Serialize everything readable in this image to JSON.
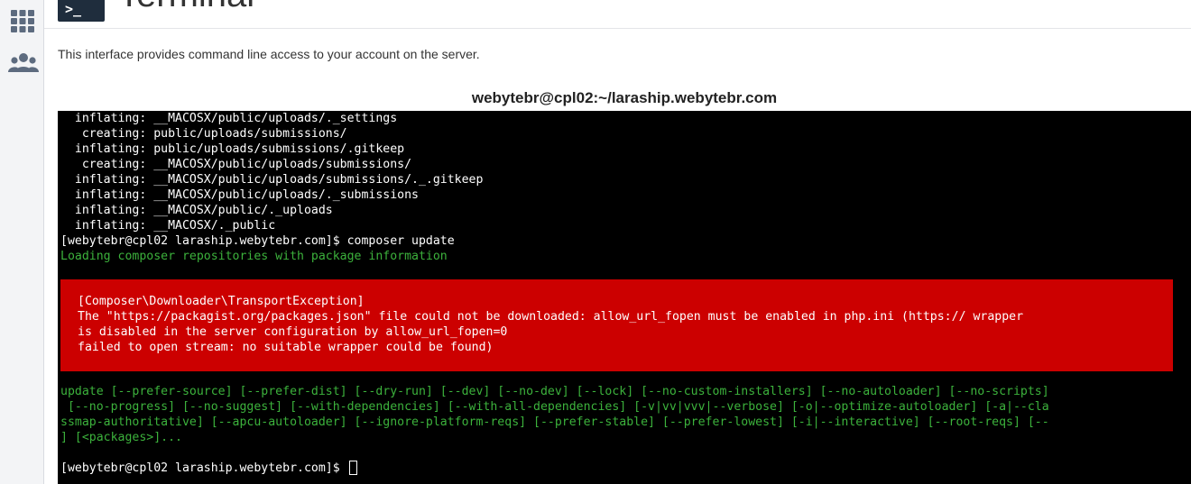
{
  "sidebar": {
    "items": [
      {
        "icon": "grid-icon",
        "label": ""
      },
      {
        "icon": "users-icon",
        "label": ""
      }
    ]
  },
  "header": {
    "badge": ">_",
    "title": "Terminal"
  },
  "description": "This interface provides command line access to your account on the server.",
  "terminal": {
    "title": "webytebr@cpl02:~/laraship.webytebr.com",
    "lines_before": [
      "  inflating: __MACOSX/public/uploads/._settings",
      "   creating: public/uploads/submissions/",
      "  inflating: public/uploads/submissions/.gitkeep",
      "   creating: __MACOSX/public/uploads/submissions/",
      "  inflating: __MACOSX/public/uploads/submissions/._.gitkeep",
      "  inflating: __MACOSX/public/uploads/._submissions",
      "  inflating: __MACOSX/public/._uploads",
      "  inflating: __MACOSX/._public",
      "[webytebr@cpl02 laraship.webytebr.com]$ composer update"
    ],
    "loading_line": "Loading composer repositories with package information",
    "error_lines": [
      "[Composer\\Downloader\\TransportException]",
      "The \"https://packagist.org/packages.json\" file could not be downloaded: allow_url_fopen must be enabled in php.ini (https:// wrapper",
      "is disabled in the server configuration by allow_url_fopen=0",
      "failed to open stream: no suitable wrapper could be found)"
    ],
    "usage_lines": [
      "update [--prefer-source] [--prefer-dist] [--dry-run] [--dev] [--no-dev] [--lock] [--no-custom-installers] [--no-autoloader] [--no-scripts]",
      " [--no-progress] [--no-suggest] [--with-dependencies] [--with-all-dependencies] [-v|vv|vvv|--verbose] [-o|--optimize-autoloader] [-a|--cla",
      "ssmap-authoritative] [--apcu-autoloader] [--ignore-platform-reqs] [--prefer-stable] [--prefer-lowest] [-i|--interactive] [--root-reqs] [--",
      "] [<packages>]..."
    ],
    "prompt": "[webytebr@cpl02 laraship.webytebr.com]$ "
  },
  "colors": {
    "terminal_bg": "#000000",
    "error_bg": "#cc0000",
    "success_text": "#3cb23c",
    "header_badge": "#1f2d3d"
  }
}
